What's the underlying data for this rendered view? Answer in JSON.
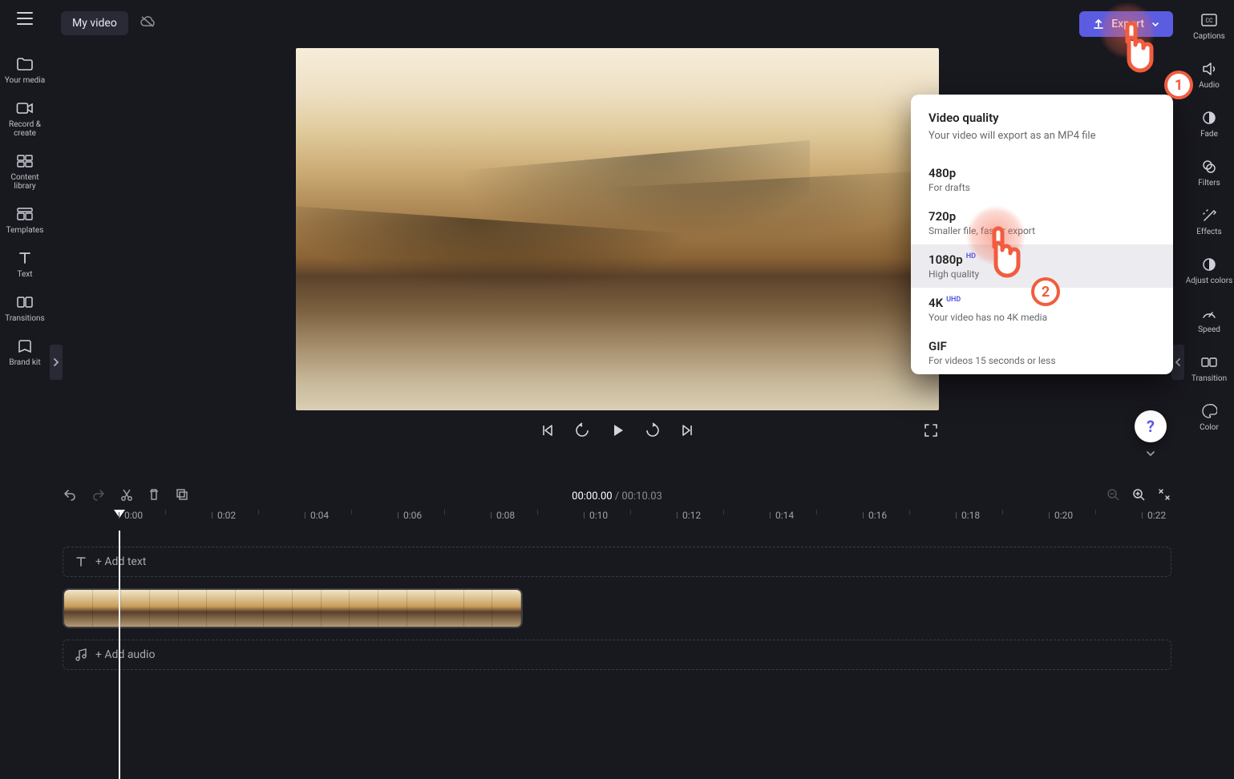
{
  "header": {
    "project_title": "My video",
    "export_label": "Export"
  },
  "left_nav": [
    {
      "label": "Your media",
      "name": "nav-your-media"
    },
    {
      "label": "Record & create",
      "name": "nav-record-create"
    },
    {
      "label": "Content library",
      "name": "nav-content-library"
    },
    {
      "label": "Templates",
      "name": "nav-templates"
    },
    {
      "label": "Text",
      "name": "nav-text"
    },
    {
      "label": "Transitions",
      "name": "nav-transitions"
    },
    {
      "label": "Brand kit",
      "name": "nav-brand-kit"
    }
  ],
  "right_nav": [
    {
      "label": "Captions",
      "name": "panel-captions"
    },
    {
      "label": "Audio",
      "name": "panel-audio"
    },
    {
      "label": "Fade",
      "name": "panel-fade"
    },
    {
      "label": "Filters",
      "name": "panel-filters"
    },
    {
      "label": "Effects",
      "name": "panel-effects"
    },
    {
      "label": "Adjust colors",
      "name": "panel-adjust-colors"
    },
    {
      "label": "Speed",
      "name": "panel-speed"
    },
    {
      "label": "Transition",
      "name": "panel-transition"
    },
    {
      "label": "Color",
      "name": "panel-color"
    }
  ],
  "export_popover": {
    "heading": "Video quality",
    "subtitle": "Your video will export as an MP4 file",
    "options": [
      {
        "title": "480p",
        "sup": "",
        "desc": "For drafts",
        "selected": false
      },
      {
        "title": "720p",
        "sup": "",
        "desc": "Smaller file, faster export",
        "selected": false
      },
      {
        "title": "1080p",
        "sup": "HD",
        "desc": "High quality",
        "selected": true
      },
      {
        "title": "4K",
        "sup": "UHD",
        "desc": "Your video has no 4K media",
        "selected": false
      },
      {
        "title": "GIF",
        "sup": "",
        "desc": "For videos 15 seconds or less",
        "selected": false
      }
    ]
  },
  "timecode": {
    "current": "00:00.00",
    "sep": "/",
    "total": "00:10.03"
  },
  "ruler_ticks": [
    "0:00",
    "0:02",
    "0:04",
    "0:06",
    "0:08",
    "0:10",
    "0:12",
    "0:14",
    "0:16",
    "0:18",
    "0:20",
    "0:22"
  ],
  "tracks": {
    "add_text": "+ Add text",
    "add_audio": "+ Add audio"
  },
  "annotations": {
    "step1": "1",
    "step2": "2"
  },
  "help": "?"
}
